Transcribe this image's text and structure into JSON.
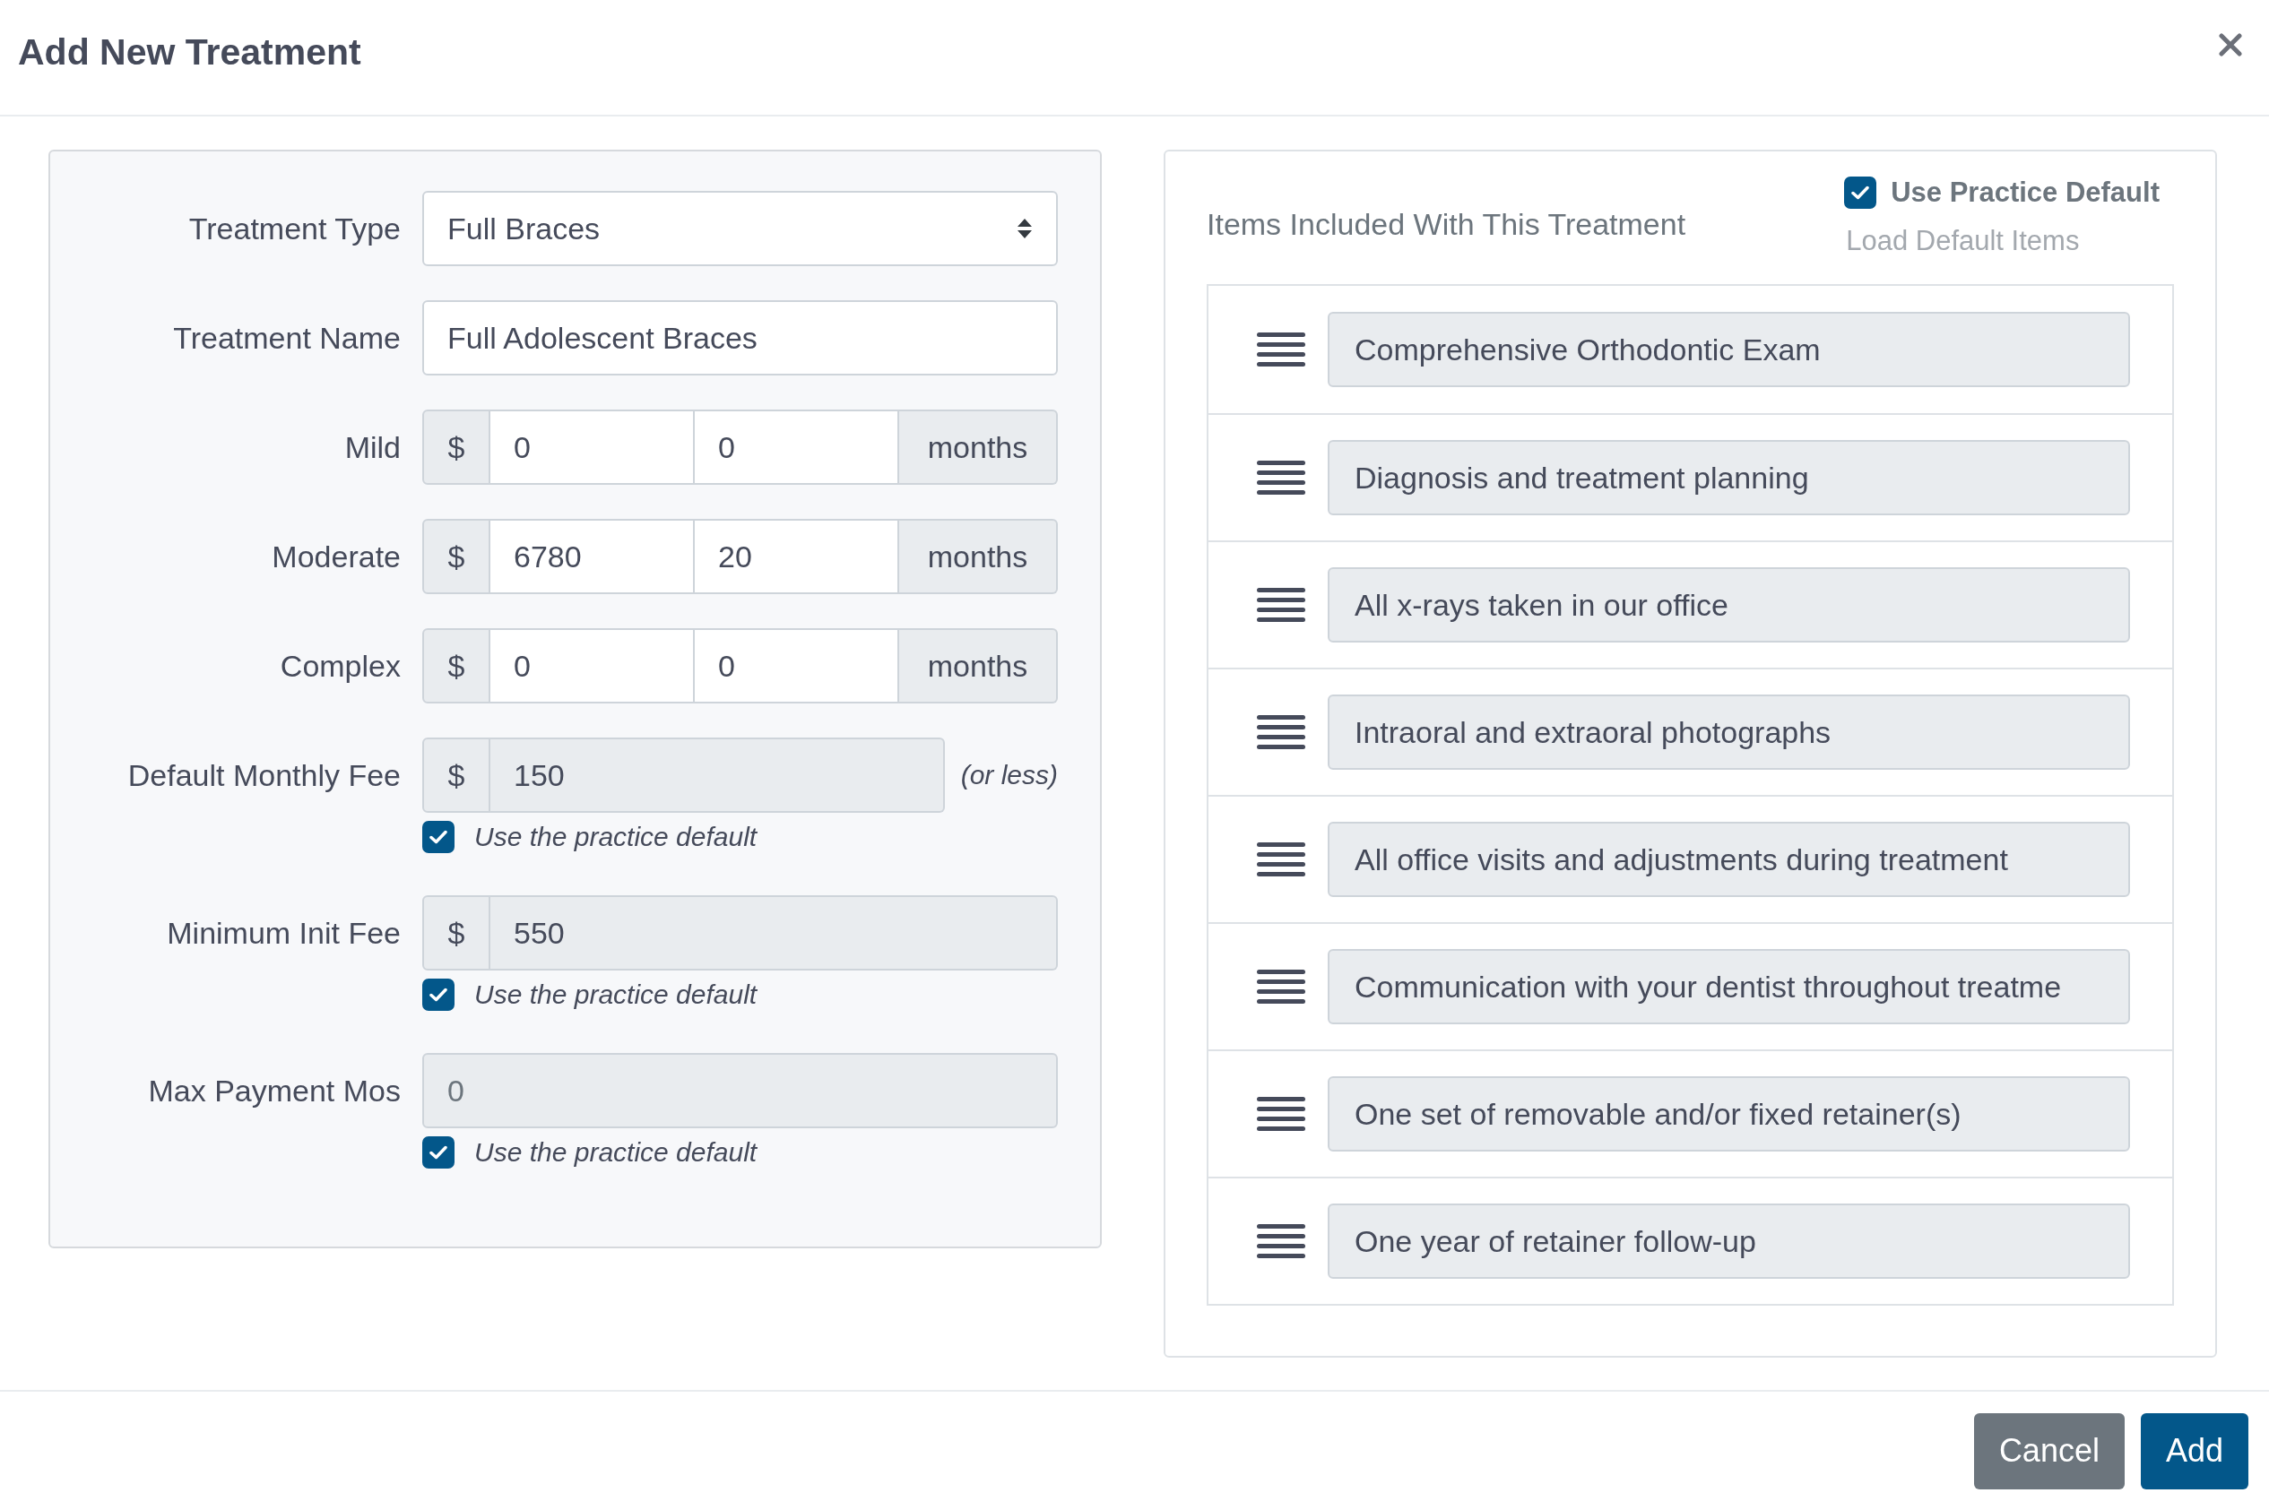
{
  "dialog": {
    "title": "Add New Treatment"
  },
  "fields": [
    {
      "kind": "select",
      "label": "Treatment Type",
      "value": "Full Braces",
      "disabled": false
    },
    {
      "kind": "text",
      "label": "Treatment Name",
      "value": "Full Adolescent Braces",
      "disabled": false
    },
    {
      "kind": "range",
      "label": "Mild",
      "prefix": "$",
      "amount": "0",
      "months": "0",
      "suffix": "months",
      "disabled": false
    },
    {
      "kind": "range",
      "label": "Moderate",
      "prefix": "$",
      "amount": "6780",
      "months": "20",
      "suffix": "months",
      "disabled": false
    },
    {
      "kind": "range",
      "label": "Complex",
      "prefix": "$",
      "amount": "0",
      "months": "0",
      "suffix": "months",
      "disabled": false
    },
    {
      "kind": "money",
      "label": "Default Monthly Fee",
      "prefix": "$",
      "value": "150",
      "note": "(or less)",
      "disabled": true,
      "default_option": {
        "label": "Use the practice default",
        "checked": true
      }
    },
    {
      "kind": "money",
      "label": "Minimum Init Fee",
      "prefix": "$",
      "value": "550",
      "disabled": true,
      "default_option": {
        "label": "Use the practice default",
        "checked": true
      }
    },
    {
      "kind": "text",
      "label": "Max Payment Mos",
      "placeholder": "0",
      "disabled": true,
      "default_option": {
        "label": "Use the practice default",
        "checked": true
      }
    }
  ],
  "items_panel": {
    "title": "Items Included With This Treatment",
    "use_default": {
      "label": "Use Practice Default",
      "checked": true
    },
    "load_default": {
      "label": "Load Default Items",
      "disabled": true
    },
    "items": [
      "Comprehensive Orthodontic Exam",
      "Diagnosis and treatment planning",
      "All x-rays taken in our office",
      "Intraoral and extraoral photographs",
      "All office visits and adjustments during treatment",
      "Communication with your dentist throughout treatme",
      "One set of removable and/or fixed retainer(s)",
      "One year of retainer follow-up"
    ]
  },
  "buttons": [
    {
      "label": "Cancel",
      "kind": "secondary"
    },
    {
      "label": "Add",
      "kind": "primary"
    }
  ]
}
